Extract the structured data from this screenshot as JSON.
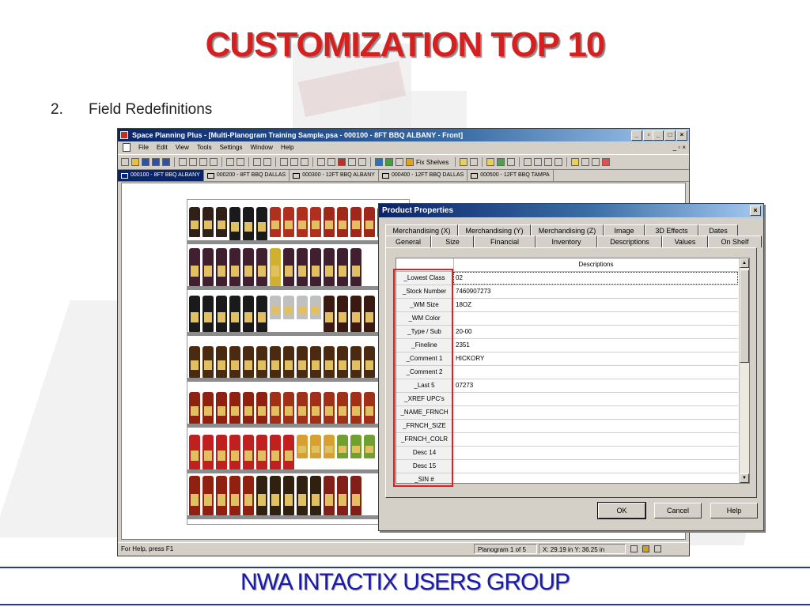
{
  "slide": {
    "title": "CUSTOMIZATION TOP 10",
    "subtitle_number": "2.",
    "subtitle_text": "Field Redefinitions",
    "footer": "NWA INTACTIX USERS GROUP"
  },
  "app": {
    "title": "Space Planning Plus - [Multi-Planogram Training Sample.psa - 000100 - 8FT BBQ ALBANY - Front]",
    "menu": [
      {
        "key": "file",
        "label": "File"
      },
      {
        "key": "edit",
        "label": "Edit"
      },
      {
        "key": "view",
        "label": "View"
      },
      {
        "key": "tools",
        "label": "Tools"
      },
      {
        "key": "settings",
        "label": "Settings"
      },
      {
        "key": "window",
        "label": "Window"
      },
      {
        "key": "help",
        "label": "Help"
      }
    ],
    "menu_right": "_ ▫ ×",
    "toolbar": {
      "fix_shelves_label": "Fix Shelves"
    },
    "planogram_tabs": [
      {
        "label": "000100 - 8FT BBQ ALBANY",
        "active": true
      },
      {
        "label": "000200 - 8FT BBQ DALLAS",
        "active": false
      },
      {
        "label": "000300 - 12FT BBQ ALBANY",
        "active": false
      },
      {
        "label": "000400 - 12FT BBQ DALLAS",
        "active": false
      },
      {
        "label": "000500 - 12FT BBQ TAMPA",
        "active": false
      }
    ],
    "status": {
      "help": "For Help, press F1",
      "planogram": "Planogram 1 of 5",
      "coords": "X: 29.19 in  Y: 36.25 in"
    }
  },
  "dialog": {
    "title": "Product Properties",
    "close": "×",
    "tabs_row1": [
      "Merchandising (X)",
      "Merchandising (Y)",
      "Merchandising (Z)",
      "Image",
      "3D Effects",
      "Dates"
    ],
    "tabs_row2": [
      "General",
      "Size",
      "Financial",
      "Inventory",
      "Descriptions",
      "Values",
      "On Shelf"
    ],
    "active_tab": "Descriptions",
    "grid_header": "Descriptions",
    "rows": [
      {
        "label": "_Lowest Class",
        "value": "02"
      },
      {
        "label": "_Stock Number",
        "value": "7460907273"
      },
      {
        "label": "_WM Size",
        "value": "18OZ"
      },
      {
        "label": "_WM Color",
        "value": ""
      },
      {
        "label": "_Type / Sub",
        "value": "20-00"
      },
      {
        "label": "_Fineline",
        "value": "2351"
      },
      {
        "label": "_Comment 1",
        "value": "HICKORY"
      },
      {
        "label": "_Comment 2",
        "value": ""
      },
      {
        "label": "_Last 5",
        "value": "07273"
      },
      {
        "label": "_XREF UPC's",
        "value": ""
      },
      {
        "label": "_NAME_FRNCH",
        "value": ""
      },
      {
        "label": "_FRNCH_SIZE",
        "value": ""
      },
      {
        "label": "_FRNCH_COLR",
        "value": ""
      },
      {
        "label": "Desc 14",
        "value": ""
      },
      {
        "label": "Desc 15",
        "value": ""
      },
      {
        "label": "_SIN #",
        "value": ""
      }
    ],
    "buttons": {
      "ok": "OK",
      "cancel": "Cancel",
      "help": "Help"
    }
  },
  "colors": {
    "title_red": "#d62020",
    "footer_blue": "#1a1aa8",
    "highlight_red": "#e02020",
    "titlebar_blue": "#0a246a"
  }
}
